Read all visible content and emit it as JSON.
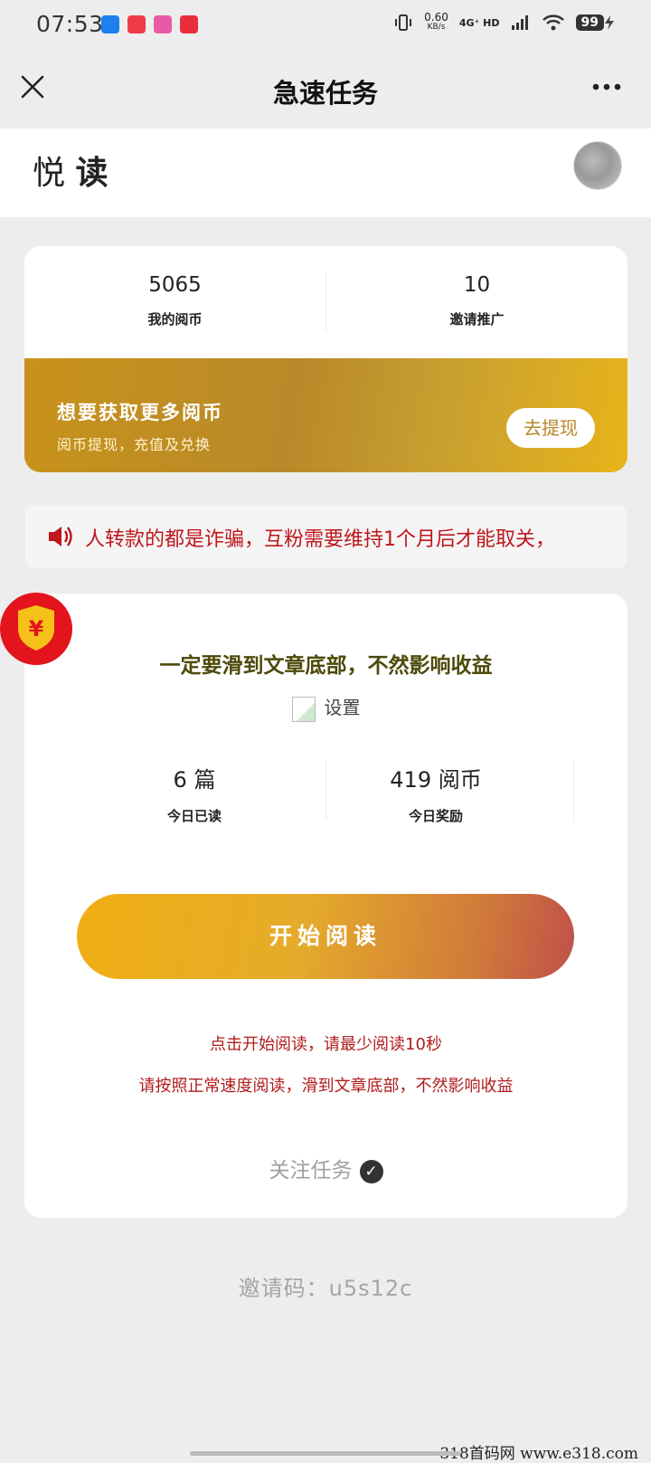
{
  "status_bar": {
    "time": "07:53",
    "speed": "0.60",
    "speed_unit": "KB/s",
    "network": "4G⁺ HD",
    "battery": "99"
  },
  "nav": {
    "title": "急速任务"
  },
  "header": {
    "brand_light": "悦",
    "brand_bold": "读"
  },
  "stats": {
    "coins_value": "5065",
    "coins_label": "我的阅币",
    "invite_value": "10",
    "invite_label": "邀请推广"
  },
  "promo": {
    "title": "想要获取更多阅币",
    "subtitle": "阅币提现，充值及兑换",
    "button": "去提现"
  },
  "notice": {
    "text": "人转款的都是诈骗，互粉需要维持1个月后才能取关，"
  },
  "task": {
    "badge_symbol": "¥",
    "title": "一定要滑到文章底部，不然影响收益",
    "settings_label": "设置",
    "read_value": "6 篇",
    "read_label": "今日已读",
    "reward_value": "419 阅币",
    "reward_label": "今日奖励",
    "start_button": "开始阅读",
    "tip1": "点击开始阅读，请最少阅读10秒",
    "tip2": "请按照正常速度阅读，滑到文章底部，不然影响收益",
    "follow_label": "关注任务"
  },
  "invite_code": "邀请码：u5s12c",
  "watermark": "318首码网  www.e318.com",
  "colors": {
    "accent_red": "#c0161c",
    "gold": "#e8b41a",
    "start_from": "#f0ae14",
    "start_to": "#c0504a"
  }
}
